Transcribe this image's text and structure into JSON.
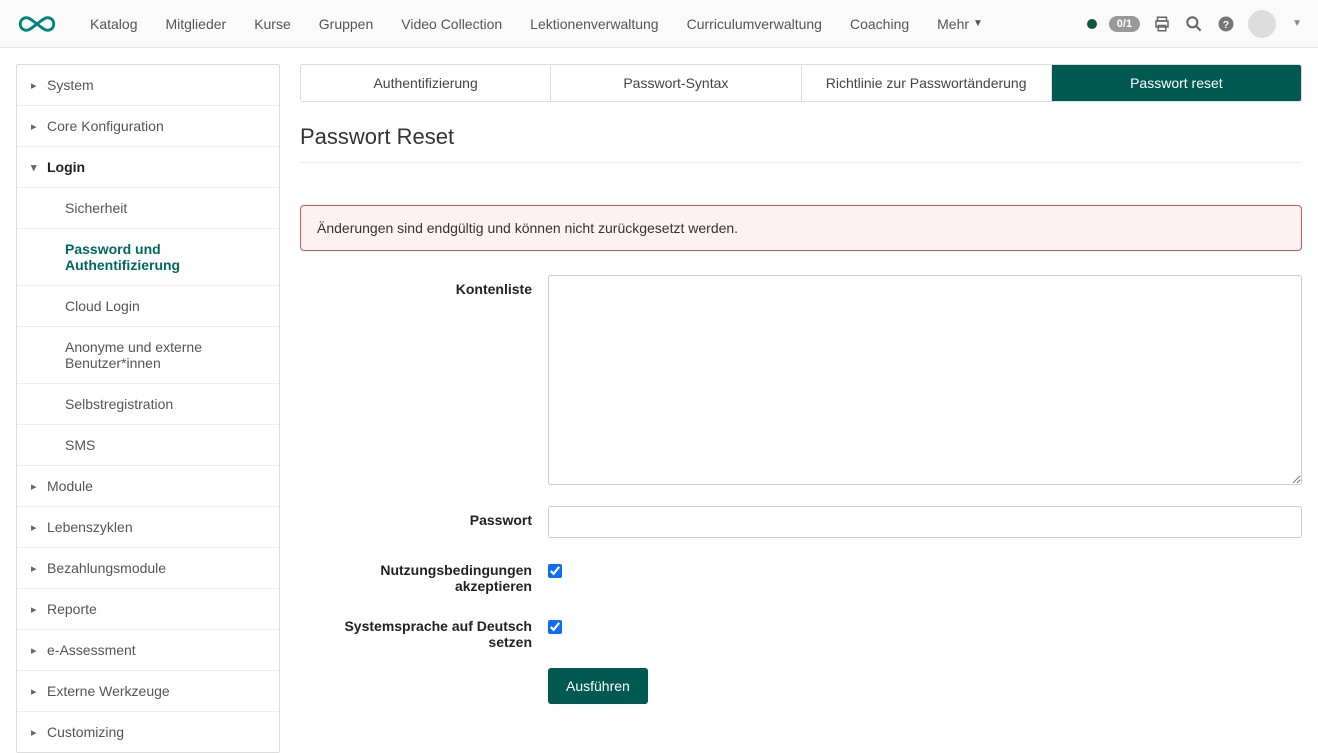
{
  "topnav": {
    "items": [
      "Katalog",
      "Mitglieder",
      "Kurse",
      "Gruppen",
      "Video Collection",
      "Lektionenverwaltung",
      "Curriculumverwaltung",
      "Coaching",
      "Mehr"
    ],
    "badge": "0/1"
  },
  "sidebar": {
    "items": [
      {
        "label": "System",
        "type": "top"
      },
      {
        "label": "Core Konfiguration",
        "type": "top"
      },
      {
        "label": "Login",
        "type": "top",
        "expanded": true
      },
      {
        "label": "Sicherheit",
        "type": "sub"
      },
      {
        "label": "Password und Authentifizierung",
        "type": "sub",
        "active": true
      },
      {
        "label": "Cloud Login",
        "type": "sub"
      },
      {
        "label": "Anonyme und externe Benutzer*innen",
        "type": "sub"
      },
      {
        "label": "Selbstregistration",
        "type": "sub"
      },
      {
        "label": "SMS",
        "type": "sub"
      },
      {
        "label": "Module",
        "type": "top"
      },
      {
        "label": "Lebenszyklen",
        "type": "top"
      },
      {
        "label": "Bezahlungsmodule",
        "type": "top"
      },
      {
        "label": "Reporte",
        "type": "top"
      },
      {
        "label": "e-Assessment",
        "type": "top"
      },
      {
        "label": "Externe Werkzeuge",
        "type": "top"
      },
      {
        "label": "Customizing",
        "type": "top"
      }
    ]
  },
  "tabs": [
    "Authentifizierung",
    "Passwort-Syntax",
    "Richtlinie zur Passwortänderung",
    "Passwort reset"
  ],
  "page_title": "Passwort Reset",
  "alert": "Änderungen sind endgültig und können nicht zurückgesetzt werden.",
  "form": {
    "accounts_label": "Kontenliste",
    "password_label": "Passwort",
    "terms_label": "Nutzungsbedingungen akzeptieren",
    "lang_label": "Systemsprache auf Deutsch setzen",
    "submit": "Ausführen"
  }
}
